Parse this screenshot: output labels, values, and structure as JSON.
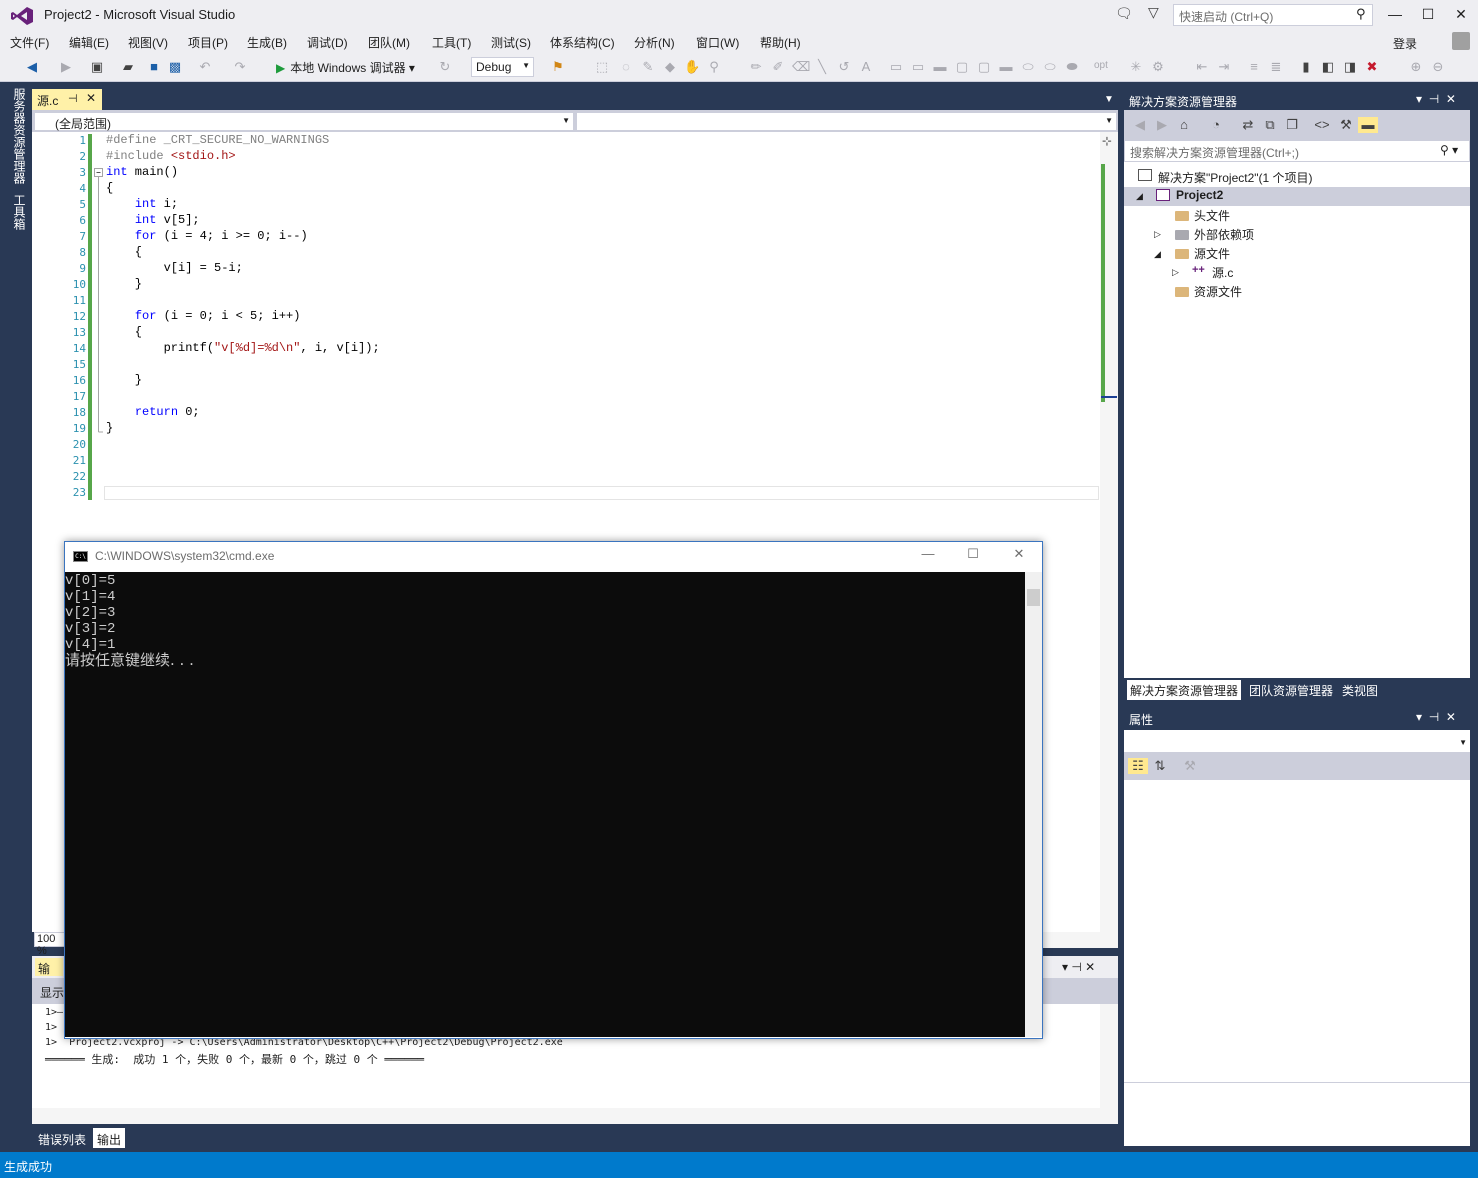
{
  "window": {
    "title": "Project2 - Microsoft Visual Studio",
    "quick_launch_placeholder": "快速启动 (Ctrl+Q)",
    "login": "登录",
    "minimize": "—",
    "maximize": "☐",
    "close": "✕"
  },
  "menu": [
    "文件(F)",
    "编辑(E)",
    "视图(V)",
    "项目(P)",
    "生成(B)",
    "调试(D)",
    "团队(M)",
    "工具(T)",
    "测试(S)",
    "体系结构(C)",
    "分析(N)",
    "窗口(W)",
    "帮助(H)"
  ],
  "toolbar": {
    "run_label": "本地 Windows 调试器",
    "config": "Debug",
    "opt": "opt"
  },
  "side_tabs": [
    "服务器资源管理器",
    "工具箱"
  ],
  "editor": {
    "tab_name": "源.c",
    "scope": "(全局范围)",
    "zoom": "100 %",
    "line_numbers": [
      "1",
      "2",
      "3",
      "4",
      "5",
      "6",
      "7",
      "8",
      "9",
      "10",
      "11",
      "12",
      "13",
      "14",
      "15",
      "16",
      "17",
      "18",
      "19",
      "20",
      "21",
      "22",
      "23"
    ]
  },
  "output": {
    "title": "输出",
    "show_label": "显示",
    "lines": [
      "1>—",
      "1>",
      "1>  Project2.vcxproj -> C:\\Users\\Administrator\\Desktop\\C++\\Project2\\Debug\\Project2.exe",
      "══════ 生成:  成功 1 个，失败 0 个，最新 0 个，跳过 0 个 ══════"
    ]
  },
  "bottom_tabs": [
    "错误列表",
    "输出"
  ],
  "solution_explorer": {
    "title": "解决方案资源管理器",
    "search_placeholder": "搜索解决方案资源管理器(Ctrl+;)",
    "solution": "解决方案\"Project2\"(1 个项目)",
    "project": "Project2",
    "items": [
      "头文件",
      "外部依赖项",
      "源文件",
      "源.c",
      "资源文件"
    ],
    "tabs": [
      "解决方案资源管理器",
      "团队资源管理器",
      "类视图"
    ]
  },
  "properties": {
    "title": "属性"
  },
  "status": {
    "text": "生成成功"
  },
  "cmd": {
    "title": "C:\\WINDOWS\\system32\\cmd.exe",
    "icon_text": "C:\\",
    "lines": [
      "v[0]=5",
      "v[1]=4",
      "v[2]=3",
      "v[3]=2",
      "v[4]=1",
      "请按任意键继续. . ."
    ]
  }
}
